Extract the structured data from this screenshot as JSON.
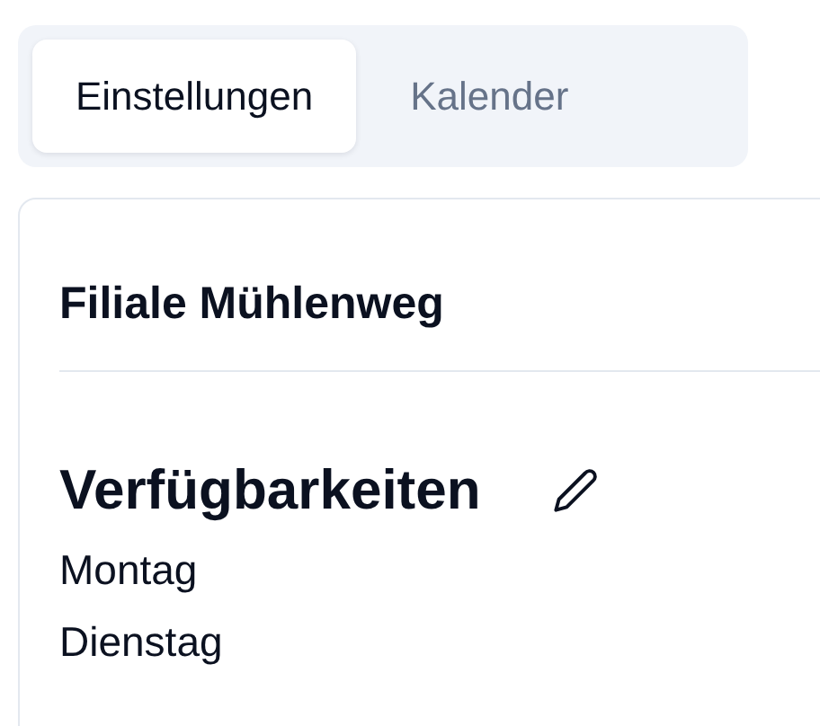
{
  "tabs": [
    {
      "label": "Einstellungen",
      "selected": true
    },
    {
      "label": "Kalender",
      "selected": false
    }
  ],
  "card": {
    "title": "Filiale Mühlenweg",
    "section_title": "Verfügbarkeiten",
    "days": [
      "Montag",
      "Dienstag"
    ]
  }
}
